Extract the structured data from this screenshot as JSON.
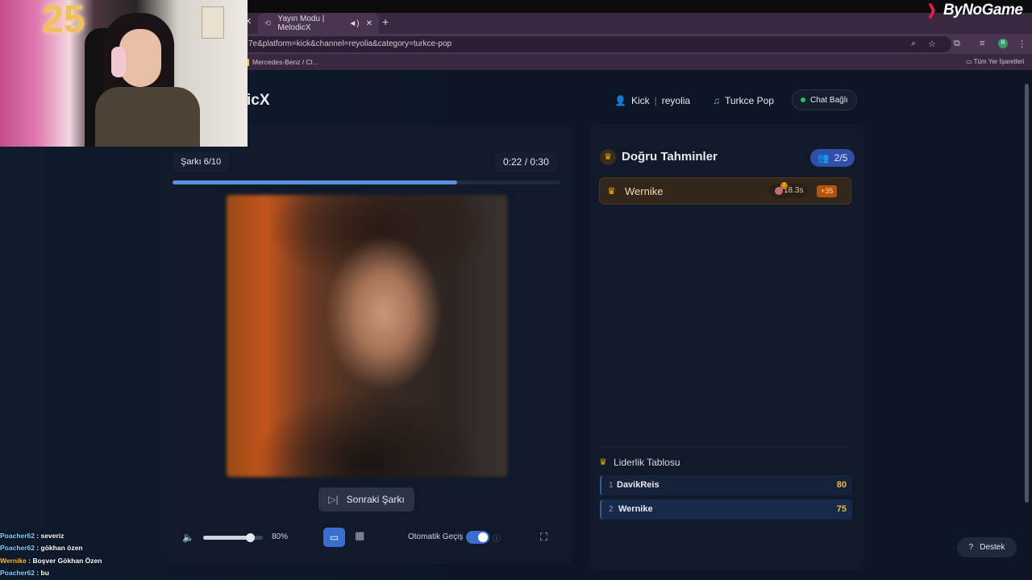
{
  "browser": {
    "tab_title": "Yayın Modu | MelodicX",
    "url": "7e&platform=kick&channel=reyolia&category=turkce-pop",
    "bookmark_1": "Mercedes-Benz / Cl...",
    "bookmarks_all": "Tüm Yer İşaretleri",
    "avatar_letter": "R"
  },
  "watermark": "ByNoGame",
  "app": {
    "brand": "icX",
    "header": {
      "platform": "Kick",
      "channel": "reyolia",
      "category": "Turkce Pop",
      "chat_status": "Chat Bağlı"
    }
  },
  "player": {
    "song_counter": "Şarkı 6/10",
    "time_elapsed": "0:22",
    "time_sep": "/",
    "time_total": "0:30",
    "progress_fraction": 0.733,
    "next_button": "Sonraki Şarkı",
    "volume_fraction": 0.8,
    "volume_label": "80%",
    "auto_advance_label": "Otomatik Geçiş",
    "auto_advance_on": true
  },
  "guesses": {
    "title": "Doğru Tahminler",
    "count": "2/5",
    "items": [
      {
        "name": "Wernike",
        "badge": "2",
        "time": "18.3s",
        "points": "+35"
      }
    ]
  },
  "leaderboard": {
    "title": "Liderlik Tablosu",
    "rows": [
      {
        "rank": "1",
        "name": "DavikReis",
        "score": "80"
      },
      {
        "rank": "2",
        "name": "Wernike",
        "score": "75"
      }
    ]
  },
  "support_button": "Destek",
  "chat": [
    {
      "user": "Poacher62",
      "message": " : severiz"
    },
    {
      "user": "Poacher62",
      "message": " : gökhan özen"
    },
    {
      "user": "Wernike",
      "message": " : Boşver Gökhan Özen"
    },
    {
      "user": "Poacher62",
      "message": " : bu"
    }
  ],
  "colors": {
    "accent": "#3b6fcf",
    "gold": "#e8b84a",
    "online": "#22c55e"
  }
}
